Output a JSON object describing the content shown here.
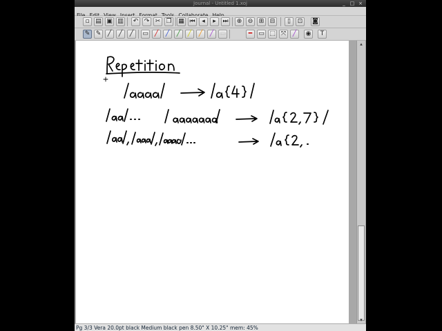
{
  "window": {
    "title": "Journal - Untitled 1.xoj"
  },
  "menu": [
    "File",
    "Edit",
    "View",
    "Insert",
    "Format",
    "Tools",
    "Collaborate",
    "Help"
  ],
  "status": {
    "text": "Pg 3/3 Vera 20.0pt black  Medium black pen  8.50\" X 10.25\"   mem: 45%"
  },
  "page": {
    "background": "#ffffff",
    "ink_color": "#000000"
  },
  "icons": {
    "toolbar1": [
      "new-page-icon",
      "open-icon",
      "save-icon",
      "print-icon",
      "undo-icon",
      "redo-icon",
      "cut-icon",
      "copy-icon",
      "paste-icon",
      "first-page-icon",
      "prev-page-icon",
      "next-page-icon",
      "last-page-icon",
      "zoom-in-icon",
      "zoom-out-icon",
      "zoom-fit-icon",
      "zoom-width-icon",
      "page-layout-icon",
      "fullscreen-icon",
      "bookmark-icon"
    ],
    "toolbar2": [
      "pen-icon",
      "pencil-icon",
      "brush-icon",
      "marker-icon",
      "highlighter-icon",
      "eraser-icon",
      "red-pen-icon",
      "blue-pen-icon",
      "green-pen-icon",
      "yellow-pen-icon",
      "orange-pen-icon",
      "purple-pen-icon",
      "white-pen-icon",
      "line-icon",
      "rectangle-icon",
      "select-icon",
      "lasso-icon",
      "color-icon",
      "image-icon",
      "text-icon"
    ]
  }
}
